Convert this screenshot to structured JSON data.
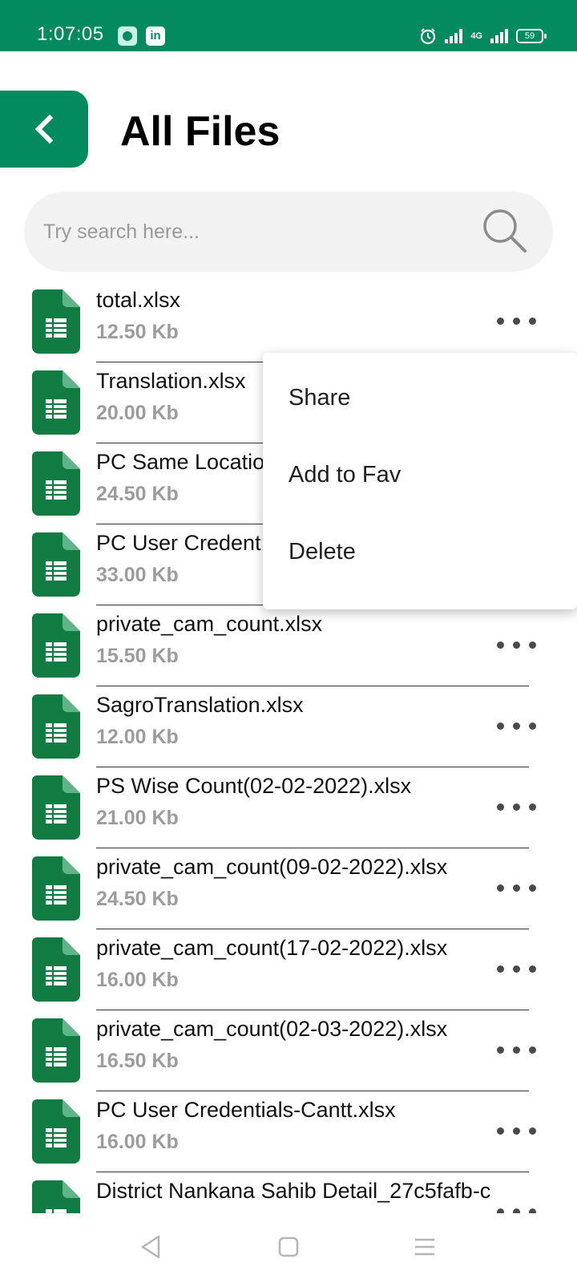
{
  "status_bar": {
    "time": "1:07:05",
    "linkedin_label": "in",
    "network_label": "4G",
    "battery_level": "59",
    "background_color": "#038a5f"
  },
  "header": {
    "title": "All Files",
    "back_icon": "chevron-left-icon"
  },
  "search": {
    "placeholder": "Try search here...",
    "value": "",
    "icon": "search-icon"
  },
  "files": [
    {
      "name": "total.xlsx",
      "size": "12.50 Kb"
    },
    {
      "name": "Translation.xlsx",
      "size": "20.00 Kb"
    },
    {
      "name": "PC Same Location",
      "size": "24.50 Kb"
    },
    {
      "name": "PC User Credent",
      "size": "33.00 Kb"
    },
    {
      "name": "private_cam_count.xlsx",
      "size": "15.50 Kb"
    },
    {
      "name": "SagroTranslation.xlsx",
      "size": "12.00 Kb"
    },
    {
      "name": "PS Wise Count(02-02-2022).xlsx",
      "size": "21.00 Kb"
    },
    {
      "name": "private_cam_count(09-02-2022).xlsx",
      "size": "24.50 Kb"
    },
    {
      "name": "private_cam_count(17-02-2022).xlsx",
      "size": "16.00 Kb"
    },
    {
      "name": "private_cam_count(02-03-2022).xlsx",
      "size": "16.50 Kb"
    },
    {
      "name": "PC User Credentials-Cantt.xlsx",
      "size": "16.00 Kb"
    },
    {
      "name": "District Nankana Sahib Detail_27c5fafb-c",
      "size": ""
    }
  ],
  "context_menu": {
    "items": [
      "Share",
      "Add to Fav",
      "Delete"
    ]
  },
  "colors": {
    "accent": "#038a5f",
    "spreadsheet_icon": "#107c41",
    "size_text": "#9c9c9c"
  }
}
